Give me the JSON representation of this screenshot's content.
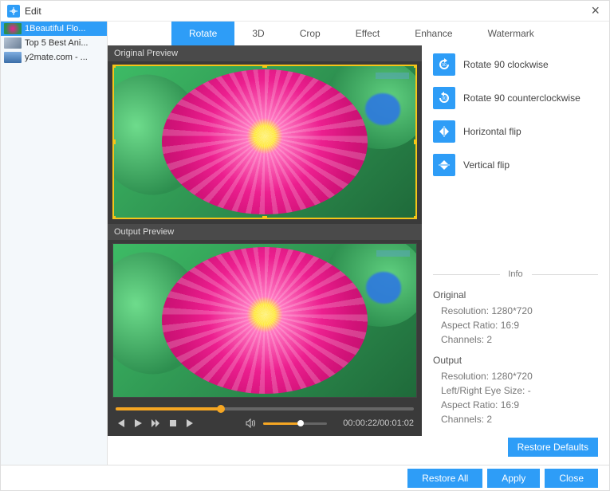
{
  "window": {
    "title": "Edit"
  },
  "sidebar": {
    "items": [
      {
        "label": "1Beautiful Flo...",
        "selected": true
      },
      {
        "label": "Top 5 Best Ani...",
        "selected": false
      },
      {
        "label": "y2mate.com - ...",
        "selected": false
      }
    ]
  },
  "tabs": [
    {
      "label": "Rotate",
      "active": true
    },
    {
      "label": "3D",
      "active": false
    },
    {
      "label": "Crop",
      "active": false
    },
    {
      "label": "Effect",
      "active": false
    },
    {
      "label": "Enhance",
      "active": false
    },
    {
      "label": "Watermark",
      "active": false
    }
  ],
  "preview": {
    "original_label": "Original Preview",
    "output_label": "Output Preview"
  },
  "player": {
    "time": "00:00:22/00:01:02",
    "progress_pct": 35,
    "volume_pct": 55
  },
  "actions": [
    {
      "label": "Rotate 90 clockwise",
      "icon": "rotate-cw"
    },
    {
      "label": "Rotate 90 counterclockwise",
      "icon": "rotate-ccw"
    },
    {
      "label": "Horizontal flip",
      "icon": "flip-h"
    },
    {
      "label": "Vertical flip",
      "icon": "flip-v"
    }
  ],
  "info": {
    "header": "Info",
    "original": {
      "title": "Original",
      "resolution": "Resolution: 1280*720",
      "aspect": "Aspect Ratio: 16:9",
      "channels": "Channels: 2"
    },
    "output": {
      "title": "Output",
      "resolution": "Resolution: 1280*720",
      "eye": "Left/Right Eye Size: -",
      "aspect": "Aspect Ratio: 16:9",
      "channels": "Channels: 2"
    }
  },
  "buttons": {
    "restore_defaults": "Restore Defaults",
    "restore_all": "Restore All",
    "apply": "Apply",
    "close": "Close"
  }
}
